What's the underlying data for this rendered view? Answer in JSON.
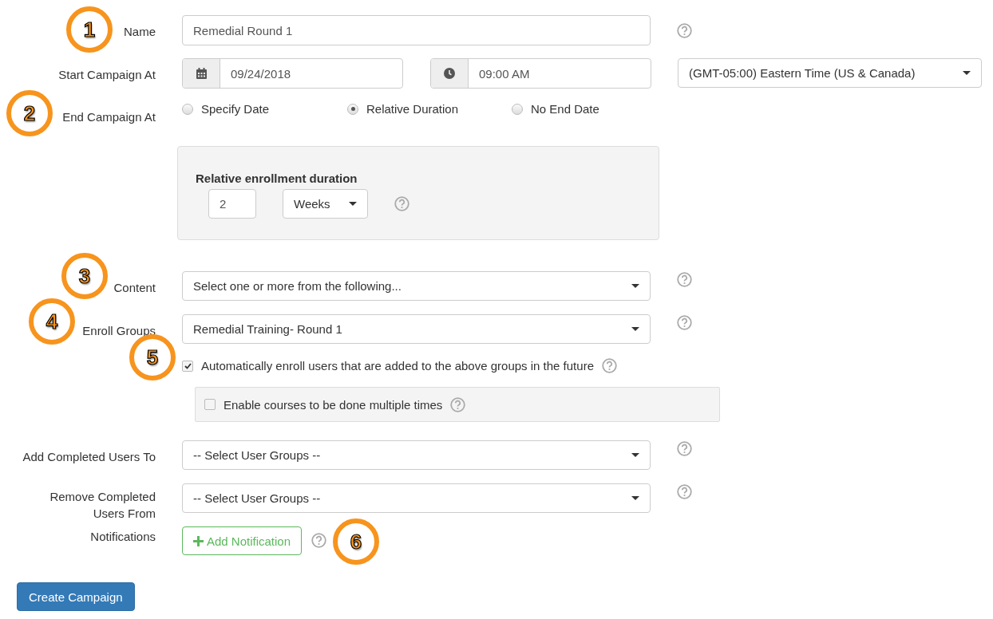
{
  "form": {
    "name": {
      "label": "Name",
      "value": "Remedial Round 1"
    },
    "start": {
      "label": "Start Campaign At",
      "date": "09/24/2018",
      "time": "09:00 AM",
      "timezone": "(GMT-05:00) Eastern Time (US & Canada)"
    },
    "end": {
      "label": "End Campaign At",
      "options": [
        {
          "label": "Specify Date",
          "selected": false
        },
        {
          "label": "Relative Duration",
          "selected": true
        },
        {
          "label": "No End Date",
          "selected": false
        }
      ],
      "relative": {
        "title": "Relative enrollment duration",
        "amount": "2",
        "unit": "Weeks"
      }
    },
    "content": {
      "label": "Content",
      "placeholder": "Select one or more from the following..."
    },
    "enroll_groups": {
      "label": "Enroll Groups",
      "value": "Remedial Training- Round 1"
    },
    "auto_enroll": {
      "label": "Automatically enroll users that are added to the above groups in the future",
      "checked": true
    },
    "multiple_times": {
      "label": "Enable courses to be done multiple times",
      "checked": false
    },
    "add_completed": {
      "label": "Add Completed Users To",
      "placeholder": "-- Select User Groups --"
    },
    "remove_completed": {
      "label": "Remove Completed Users From",
      "placeholder": "-- Select User Groups --"
    },
    "notifications": {
      "label": "Notifications",
      "button": "Add Notification"
    }
  },
  "submit": "Create Campaign",
  "callouts": [
    {
      "number": "1"
    },
    {
      "number": "2"
    },
    {
      "number": "3"
    },
    {
      "number": "4"
    },
    {
      "number": "5"
    },
    {
      "number": "6"
    }
  ]
}
